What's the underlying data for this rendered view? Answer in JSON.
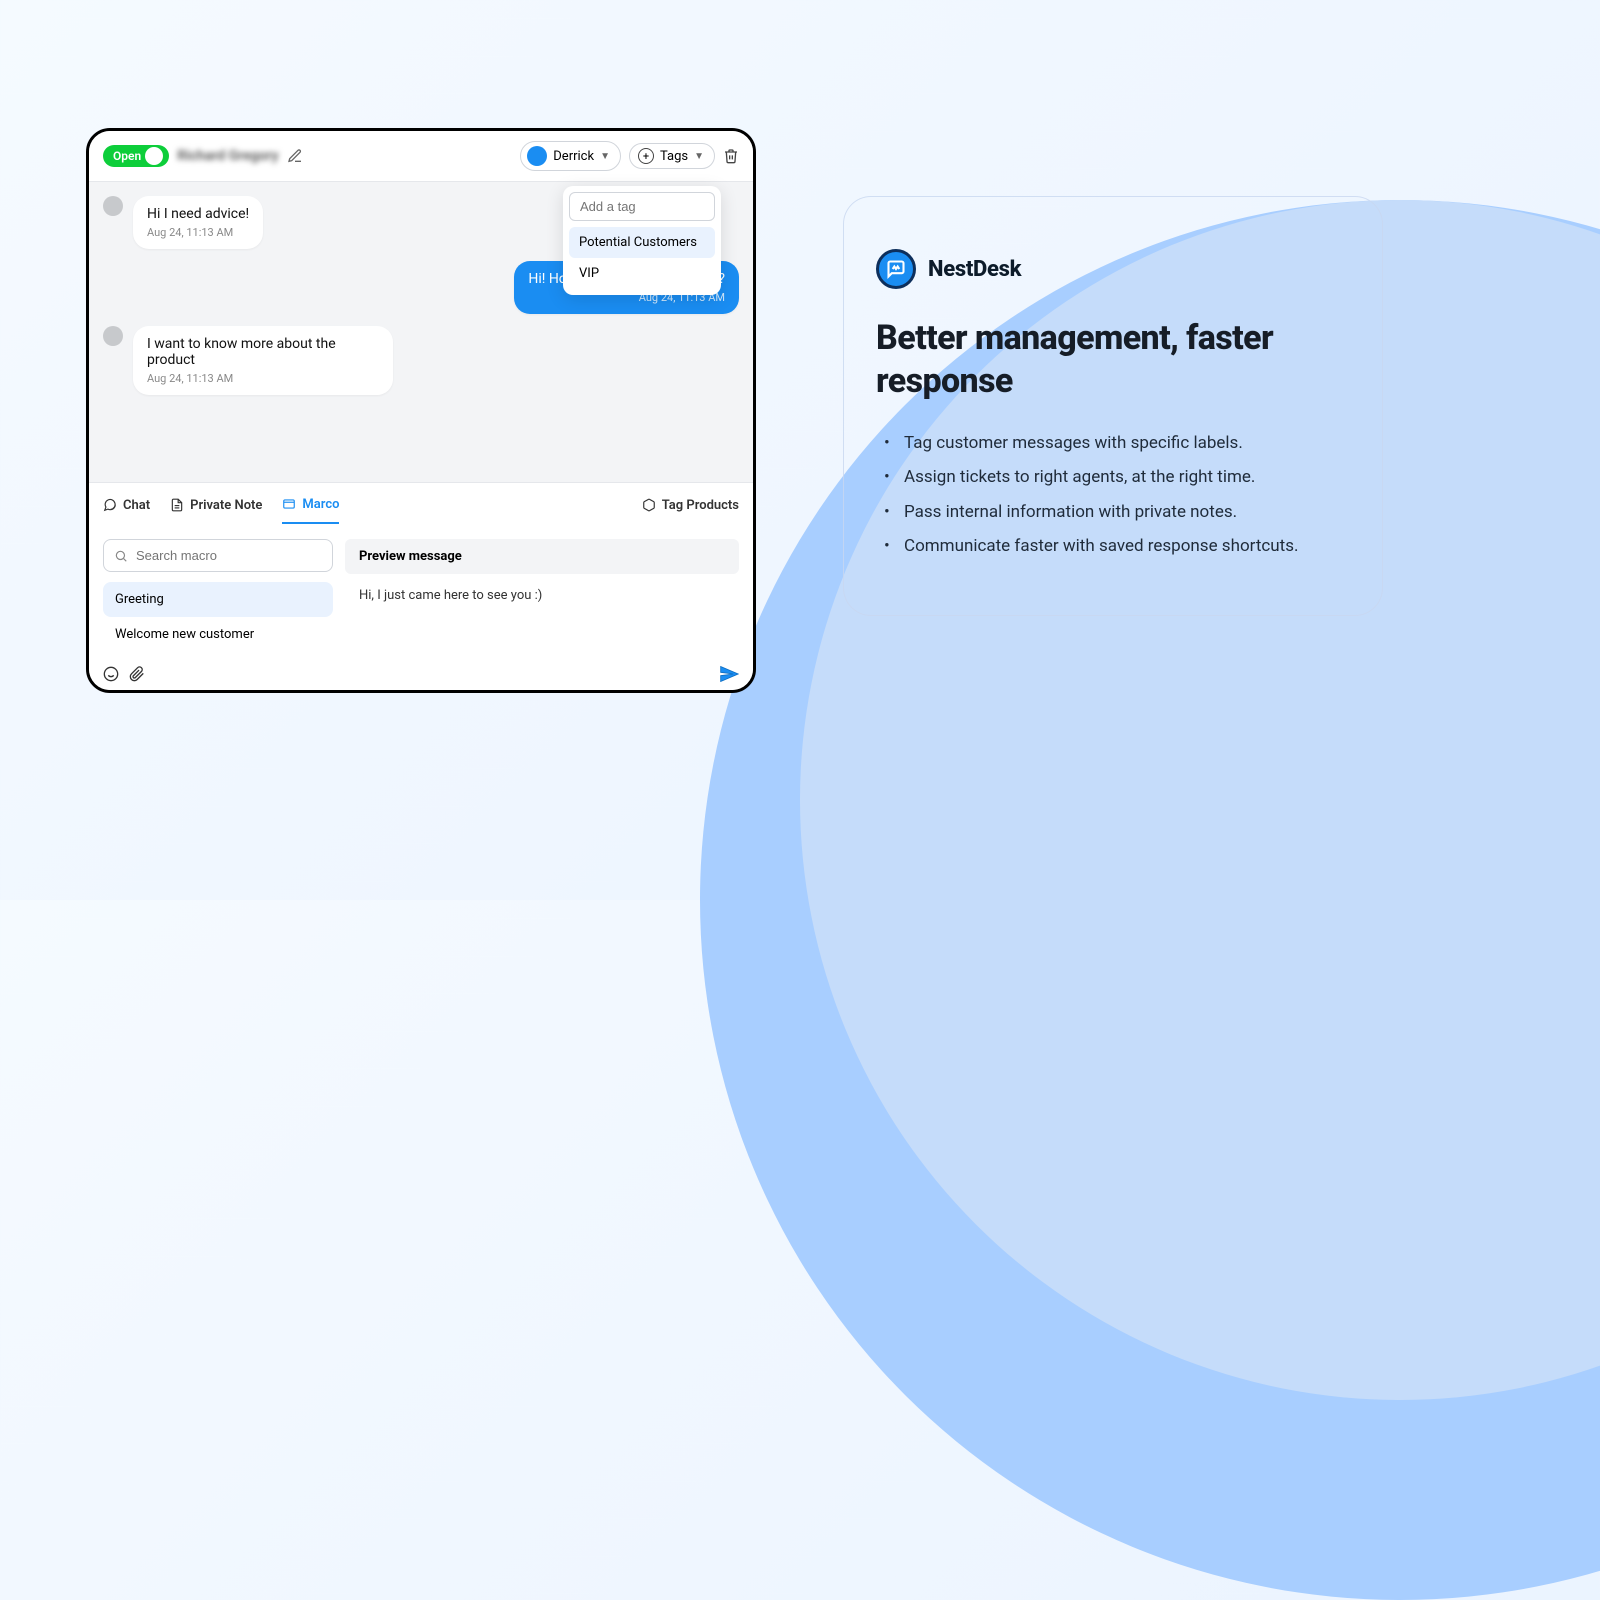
{
  "header": {
    "status": "Open",
    "customer_name": "Richard Gregory",
    "agent": "Derrick",
    "tags_label": "Tags"
  },
  "tag_dropdown": {
    "placeholder": "Add a tag",
    "options": [
      "Potential Customers",
      "VIP"
    ]
  },
  "messages": [
    {
      "side": "left",
      "text": "Hi I need advice!",
      "time": "Aug 24, 11:13 AM"
    },
    {
      "side": "right",
      "text": "Hi! How can we help you today?",
      "time": "Aug 24, 11:13 AM"
    },
    {
      "side": "left",
      "text": "I want to know more about the product",
      "time": "Aug 24, 11:13 AM"
    }
  ],
  "composer": {
    "tabs": {
      "chat": "Chat",
      "private_note": "Private Note",
      "marco": "Marco"
    },
    "tag_products": "Tag Products",
    "search_placeholder": "Search macro",
    "macros": [
      "Greeting",
      "Welcome new customer"
    ],
    "preview_label": "Preview message",
    "preview_text": "Hi, I just came here to see you :)"
  },
  "info": {
    "brand": "NestDesk",
    "headline": "Better management, faster response",
    "bullets": [
      "Tag customer messages with specific labels.",
      "Assign tickets to right agents, at the right time.",
      "Pass internal information with private notes.",
      "Communicate faster with saved response shortcuts."
    ]
  }
}
